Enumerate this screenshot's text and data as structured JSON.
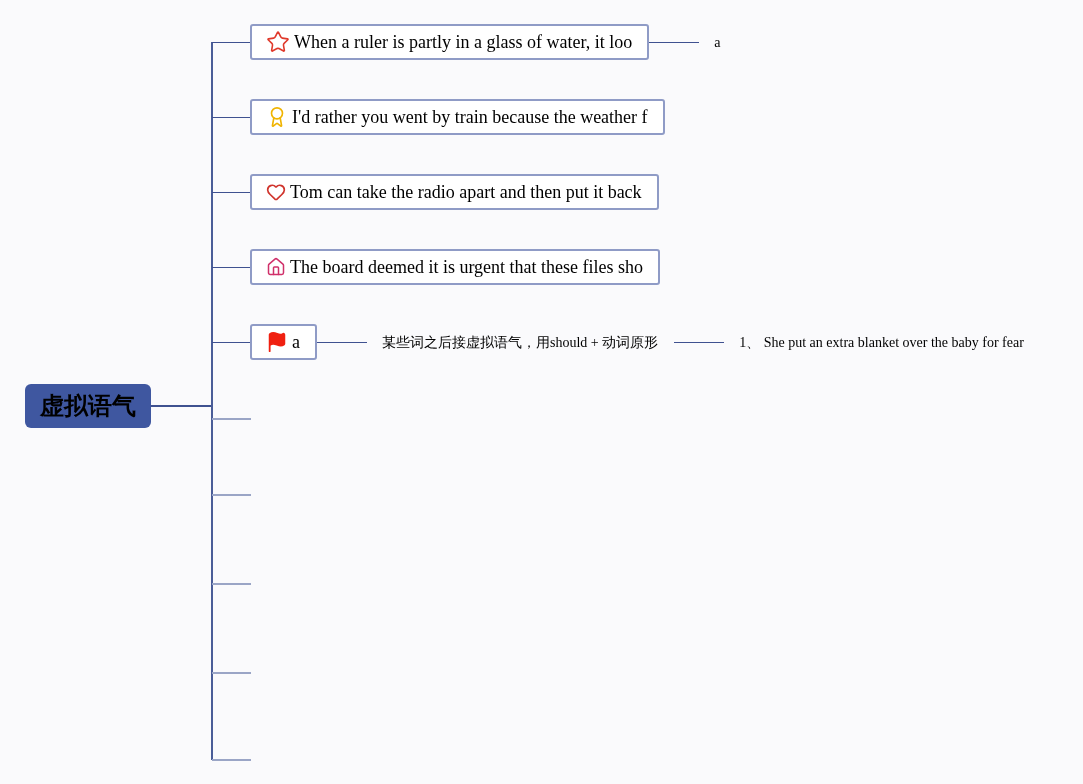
{
  "root": {
    "label": "虚拟语气"
  },
  "branches": [
    {
      "kind": "star",
      "label": "When a ruler is partly in a glass of water, it loo",
      "children": [
        {
          "label": "a"
        }
      ]
    },
    {
      "kind": "medal",
      "label": "I'd rather you went by train because the weather f"
    },
    {
      "kind": "heart",
      "label": "Tom can take the radio apart and then put it back"
    },
    {
      "kind": "house",
      "label": "The board deemed it is urgent that these files sho"
    },
    {
      "kind": "flag",
      "label": "a",
      "children": [
        {
          "label": "某些词之后接虚拟语气，用should + 动词原形",
          "children": [
            {
              "label": "1、 She put an extra blanket over the baby for fear"
            }
          ]
        }
      ]
    }
  ]
}
